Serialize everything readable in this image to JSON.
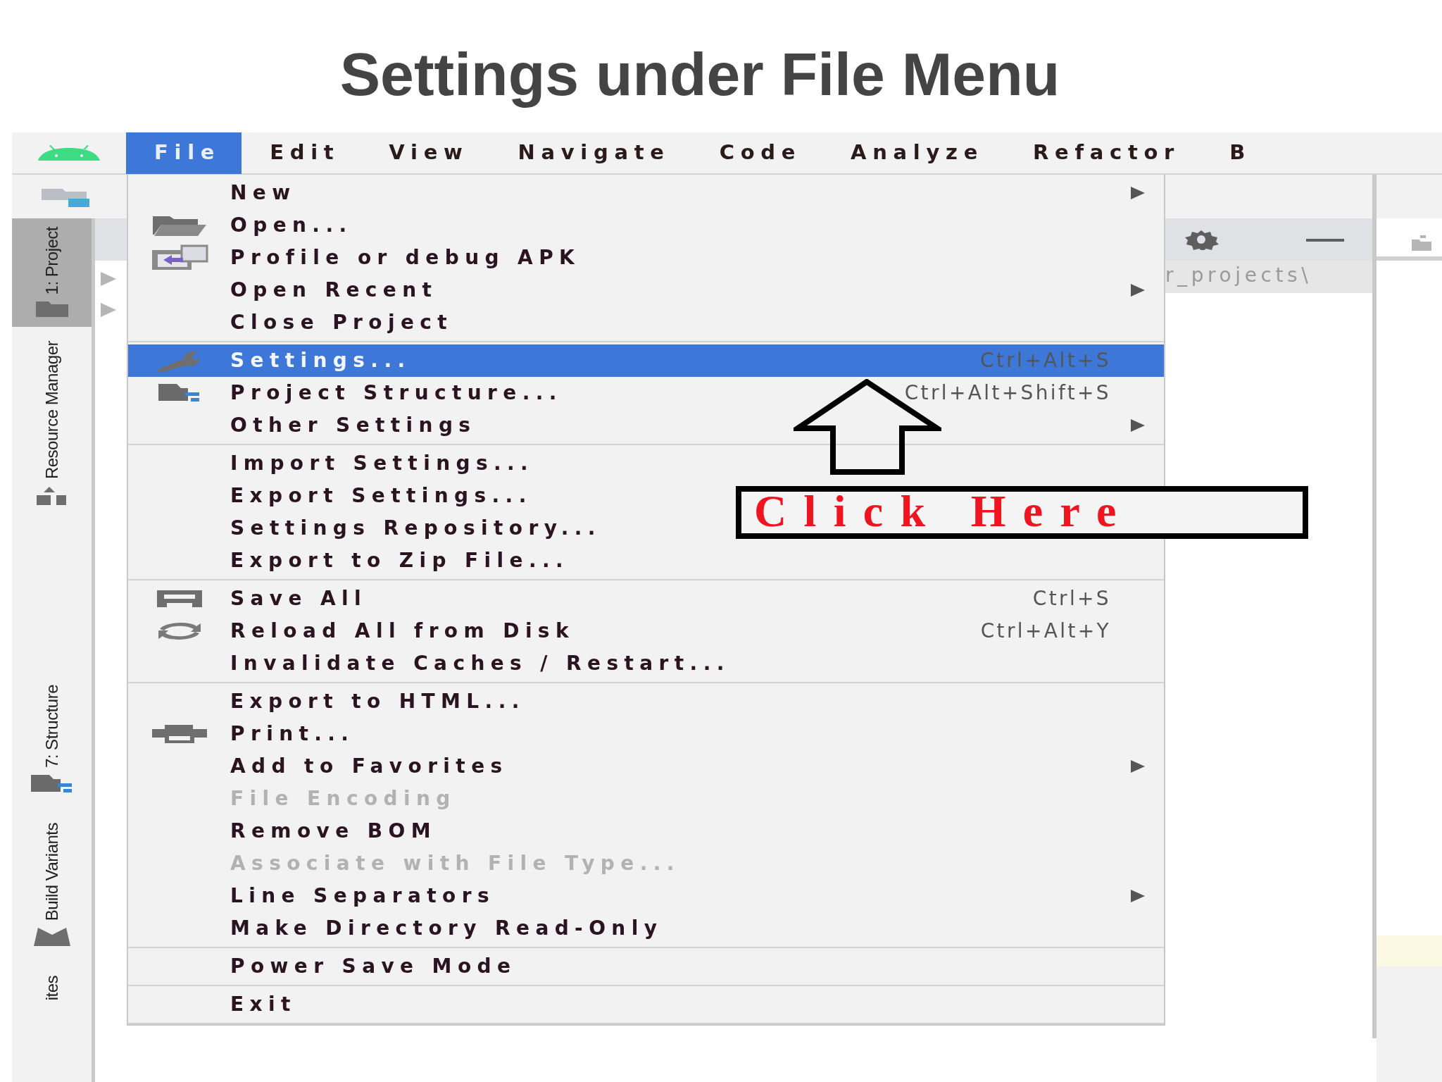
{
  "title": "Settings under File Menu",
  "menubar": [
    {
      "label": "File",
      "selected": true
    },
    {
      "label": "Edit",
      "selected": false
    },
    {
      "label": "View",
      "selected": false
    },
    {
      "label": "Navigate",
      "selected": false
    },
    {
      "label": "Code",
      "selected": false
    },
    {
      "label": "Analyze",
      "selected": false
    },
    {
      "label": "Refactor",
      "selected": false
    },
    {
      "label": "B",
      "selected": false
    }
  ],
  "tool_strip": {
    "top": [
      {
        "label": "1: Project",
        "selected": true
      },
      {
        "label": "Resource Manager",
        "selected": false
      }
    ],
    "bottom": [
      {
        "label": "7: Structure",
        "selected": false
      },
      {
        "label": "Build Variants",
        "selected": false
      },
      {
        "label": "ites",
        "selected": false
      }
    ]
  },
  "file_menu": {
    "sections": [
      [
        {
          "label": "New",
          "submenu": true,
          "disabled": false,
          "selected": false
        },
        {
          "label": "Open...",
          "submenu": false,
          "disabled": false,
          "selected": false
        },
        {
          "label": "Profile or debug APK",
          "submenu": false,
          "disabled": false,
          "selected": false
        },
        {
          "label": "Open Recent",
          "submenu": true,
          "disabled": false,
          "selected": false
        },
        {
          "label": "Close Project",
          "submenu": false,
          "disabled": false,
          "selected": false
        }
      ],
      [
        {
          "label": "Settings...",
          "shortcut": "Ctrl+Alt+S",
          "submenu": false,
          "disabled": false,
          "selected": true
        },
        {
          "label": "Project Structure...",
          "shortcut": "Ctrl+Alt+Shift+S",
          "submenu": false,
          "disabled": false,
          "selected": false
        },
        {
          "label": "Other Settings",
          "submenu": true,
          "disabled": false,
          "selected": false
        }
      ],
      [
        {
          "label": "Import Settings...",
          "submenu": false,
          "disabled": false,
          "selected": false
        },
        {
          "label": "Export Settings...",
          "submenu": false,
          "disabled": false,
          "selected": false
        },
        {
          "label": "Settings Repository...",
          "submenu": false,
          "disabled": false,
          "selected": false
        },
        {
          "label": "Export to Zip File...",
          "submenu": false,
          "disabled": false,
          "selected": false
        }
      ],
      [
        {
          "label": "Save All",
          "shortcut": "Ctrl+S",
          "submenu": false,
          "disabled": false,
          "selected": false
        },
        {
          "label": "Reload All from Disk",
          "shortcut": "Ctrl+Alt+Y",
          "submenu": false,
          "disabled": false,
          "selected": false
        },
        {
          "label": "Invalidate Caches / Restart...",
          "submenu": false,
          "disabled": false,
          "selected": false
        }
      ],
      [
        {
          "label": "Export to HTML...",
          "submenu": false,
          "disabled": false,
          "selected": false
        },
        {
          "label": "Print...",
          "submenu": false,
          "disabled": false,
          "selected": false
        },
        {
          "label": "Add to Favorites",
          "submenu": true,
          "disabled": false,
          "selected": false
        },
        {
          "label": "File Encoding",
          "submenu": false,
          "disabled": true,
          "selected": false
        },
        {
          "label": "Remove BOM",
          "submenu": false,
          "disabled": false,
          "selected": false
        },
        {
          "label": "Associate with File Type...",
          "submenu": false,
          "disabled": true,
          "selected": false
        },
        {
          "label": "Line Separators",
          "submenu": true,
          "disabled": false,
          "selected": false
        },
        {
          "label": "Make Directory Read-Only",
          "submenu": false,
          "disabled": false,
          "selected": false
        }
      ],
      [
        {
          "label": "Power Save Mode",
          "submenu": false,
          "disabled": false,
          "selected": false
        }
      ],
      [
        {
          "label": "Exit",
          "submenu": false,
          "disabled": false,
          "selected": false
        }
      ]
    ]
  },
  "project_panel": {
    "path": "r_projects\\"
  },
  "annotation": {
    "callout": "Click Here"
  }
}
